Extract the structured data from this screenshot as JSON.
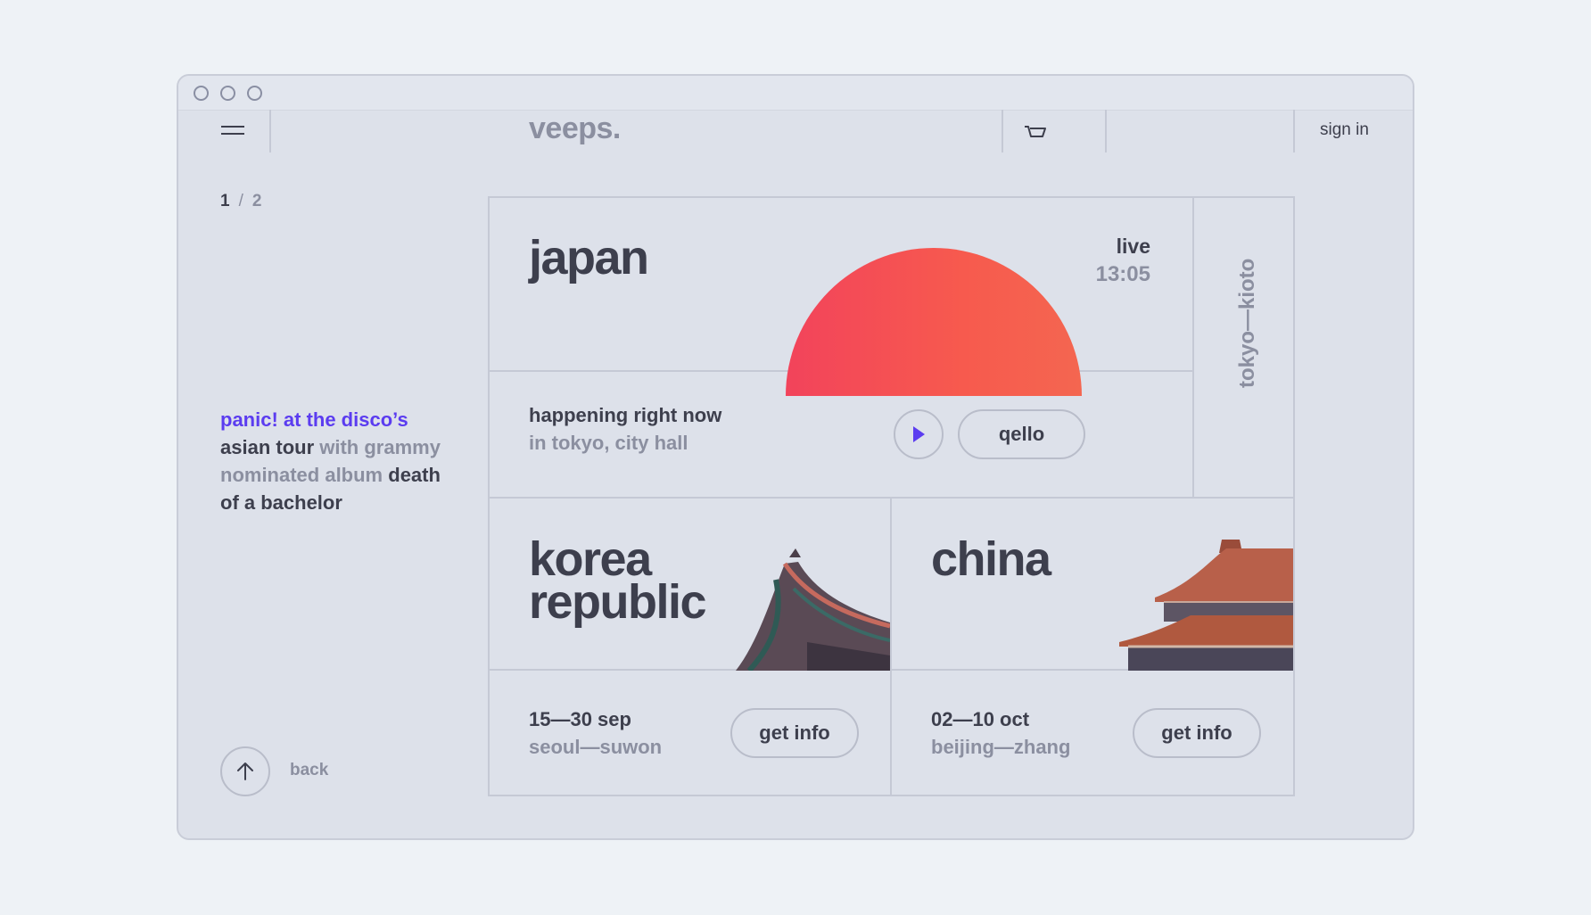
{
  "header": {
    "logo": "veeps.",
    "sign_in": "sign in"
  },
  "pager": {
    "current": "1",
    "separator": "/",
    "total": "2"
  },
  "description": {
    "part1": "panic! at the disco’s",
    "part2": "asian tour",
    "part3": " with grammy nominated album ",
    "part4": "death of a bachelor"
  },
  "back_label": "back",
  "japan": {
    "name": "japan",
    "status": "live",
    "time": "13:05",
    "line1": "happening right now",
    "line2": "in tokyo, city hall",
    "stream_button": "qello",
    "route": "tokyo—kioto"
  },
  "korea": {
    "name_line1": "korea",
    "name_line2": "republic",
    "dates": "15—30 sep",
    "cities": "seoul—suwon",
    "button": "get info"
  },
  "china": {
    "name": "china",
    "dates": "02—10 oct",
    "cities": "beijing—zhang",
    "button": "get info"
  },
  "colors": {
    "accent": "#5b3cf0",
    "sun": "#f2435b",
    "background": "#dde1ea"
  }
}
